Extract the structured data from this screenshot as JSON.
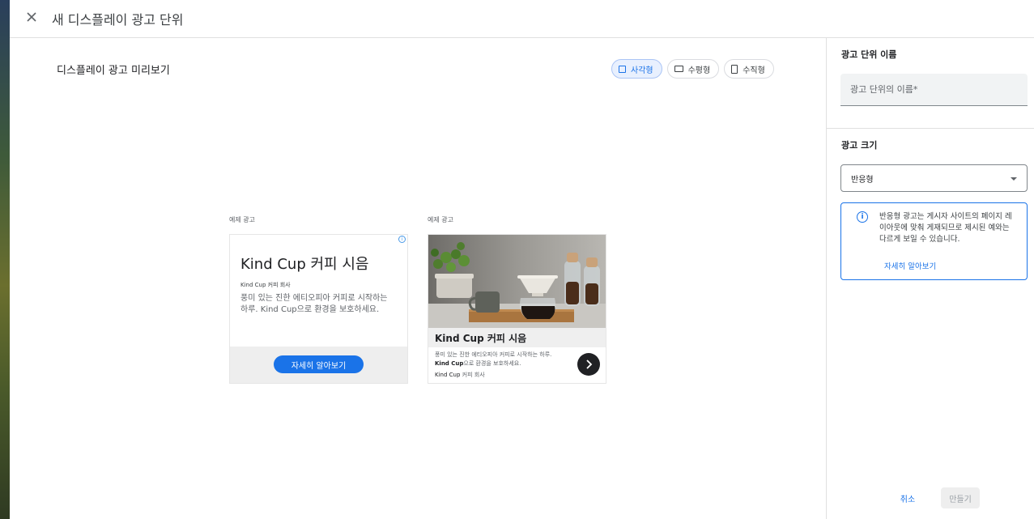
{
  "header": {
    "title": "새 디스플레이 광고 단위",
    "close_icon": "close-icon"
  },
  "preview": {
    "title": "디스플레이 광고 미리보기",
    "toggles": [
      {
        "label": "사각형",
        "icon": "square-icon",
        "active": true
      },
      {
        "label": "수평형",
        "icon": "horizontal-rect-icon",
        "active": false
      },
      {
        "label": "수직형",
        "icon": "vertical-rect-icon",
        "active": false
      }
    ]
  },
  "ads": [
    {
      "label": "예제 광고",
      "headline": "Kind Cup 커피 시음",
      "advertiser": "Kind Cup 커피 회사",
      "body": "풍미 있는 진한 에티오피아 커피로 시작하는 하루. Kind Cup으로 환경을 보호하세요.",
      "cta": "자세히 알아보기",
      "info_icon": "adchoices-info-icon"
    },
    {
      "label": "예제 광고",
      "headline": "Kind Cup 커피 시음",
      "body_pre": "풍미 있는 진한 에티오피아 커피로 시작하는 하루. ",
      "body_brand": "Kind Cup",
      "body_post": "으로 환경을 보호하세요.",
      "advertiser_brand": "Kind Cup",
      "advertiser_rest": " 커피 회사",
      "photo_icon": "coffee-photo",
      "arrow_icon": "chevron-right-icon"
    }
  ],
  "sidebar": {
    "name_section_title": "광고 단위 이름",
    "name_placeholder": "광고 단위의 이름*",
    "size_section_title": "광고 크기",
    "size_selected": "반응형",
    "notice_text": "반응형 광고는 게시자 사이트의 페이지 레이아웃에 맞춰 게재되므로 제시된 예와는 다르게 보일 수 있습니다.",
    "notice_link": "자세히 알아보기",
    "info_icon": "info-icon"
  },
  "actions": {
    "cancel": "취소",
    "create": "만들기"
  },
  "colors": {
    "accent": "#1a73e8",
    "active_toggle_bg": "#e8f0fe",
    "divider": "#e0e0e0"
  }
}
